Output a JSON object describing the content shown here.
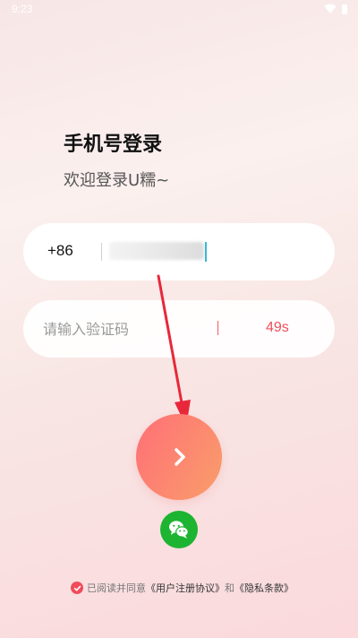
{
  "status_bar": {
    "time": "9:23"
  },
  "header": {
    "title": "手机号登录",
    "subtitle": "欢迎登录U糯~"
  },
  "phone_field": {
    "country_code": "+86",
    "value": ""
  },
  "code_field": {
    "placeholder": "请输入验证码",
    "countdown": "49s"
  },
  "agreement": {
    "prefix": "已阅读并同意",
    "user_agreement": "《用户注册协议》",
    "conjunction": "和",
    "privacy_policy": "《隐私条款》"
  },
  "colors": {
    "accent": "#ef4d5b",
    "button_gradient_start": "#ff6f77",
    "button_gradient_end": "#f99e6a",
    "wechat_green": "#1db431"
  },
  "icons": {
    "submit": "chevron-right-icon",
    "wechat": "wechat-icon",
    "checkbox": "check-circle-icon"
  }
}
